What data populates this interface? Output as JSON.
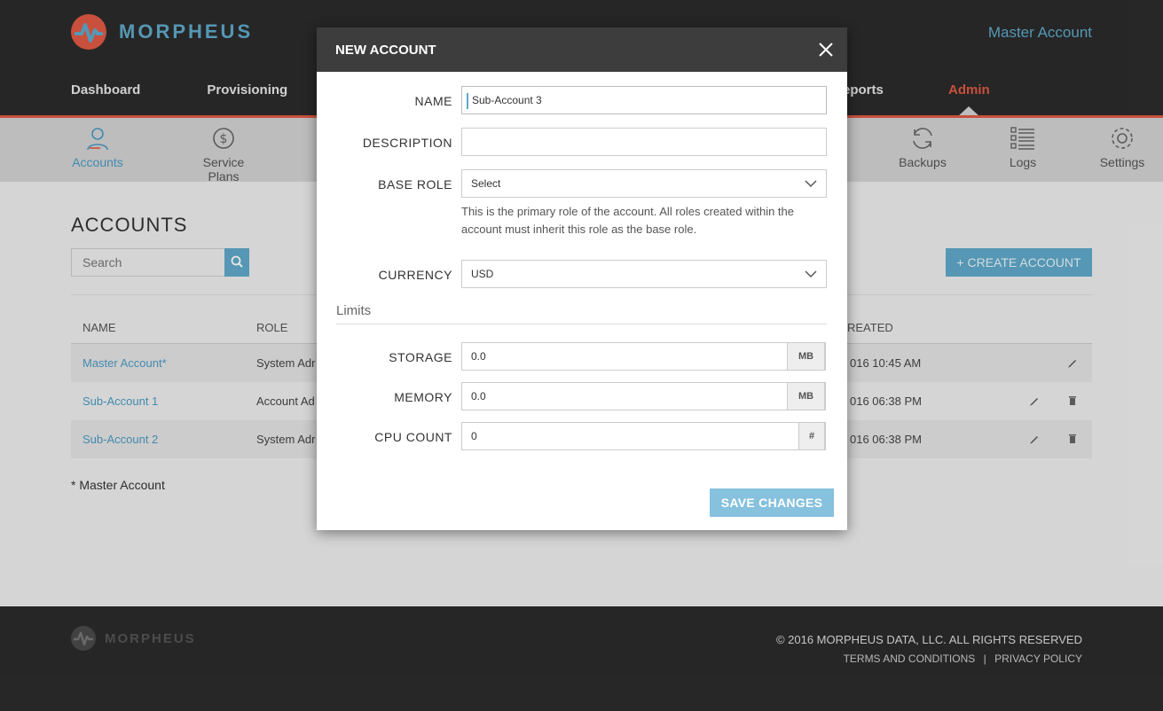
{
  "app": {
    "brand": "MORPHEUS",
    "account_link": "Master Account"
  },
  "main_nav": {
    "items": [
      "Dashboard",
      "Provisioning"
    ],
    "reports": "eports",
    "admin": "Admin"
  },
  "sub_nav": {
    "accounts": "Accounts",
    "service_plans": "Service Plans",
    "backups": "Backups",
    "logs": "Logs",
    "settings": "Settings"
  },
  "page": {
    "title": "ACCOUNTS",
    "search_placeholder": "Search",
    "create_button": "+ CREATE ACCOUNT",
    "columns": {
      "name": "NAME",
      "role": "ROLE",
      "created": "REATED"
    },
    "rows": [
      {
        "name": "Master Account*",
        "role": "System Adr",
        "created": "016 10:45 AM"
      },
      {
        "name": "Sub-Account 1",
        "role": "Account Ad",
        "created": "016 06:38 PM"
      },
      {
        "name": "Sub-Account 2",
        "role": "System Adr",
        "created": "016 06:38 PM"
      }
    ],
    "footnote": "* Master Account"
  },
  "footer": {
    "brand": "MORPHEUS",
    "copyright": "© 2016 MORPHEUS DATA, LLC. ALL RIGHTS RESERVED",
    "terms": "TERMS AND CONDITIONS",
    "separator": "|",
    "privacy": "PRIVACY POLICY"
  },
  "modal": {
    "title": "NEW ACCOUNT",
    "fields": {
      "name_label": "NAME",
      "name_value": "Sub-Account 3",
      "description_label": "DESCRIPTION",
      "description_value": "",
      "base_role_label": "BASE ROLE",
      "base_role_value": "Select",
      "base_role_help": "This is the primary role of the account. All roles created within the account must inherit this role as the base role.",
      "currency_label": "CURRENCY",
      "currency_value": "USD"
    },
    "limits": {
      "heading": "Limits",
      "storage_label": "STORAGE",
      "storage_value": "0.0",
      "storage_unit": "MB",
      "memory_label": "MEMORY",
      "memory_value": "0.0",
      "memory_unit": "MB",
      "cpu_label": "CPU COUNT",
      "cpu_value": "0",
      "cpu_unit": "#"
    },
    "save_button": "SAVE CHANGES"
  },
  "colors": {
    "accent": "#5fa9c9",
    "brand_red": "#e05a44",
    "header_bg": "#2b2b2b",
    "save_button": "#86c1de"
  }
}
